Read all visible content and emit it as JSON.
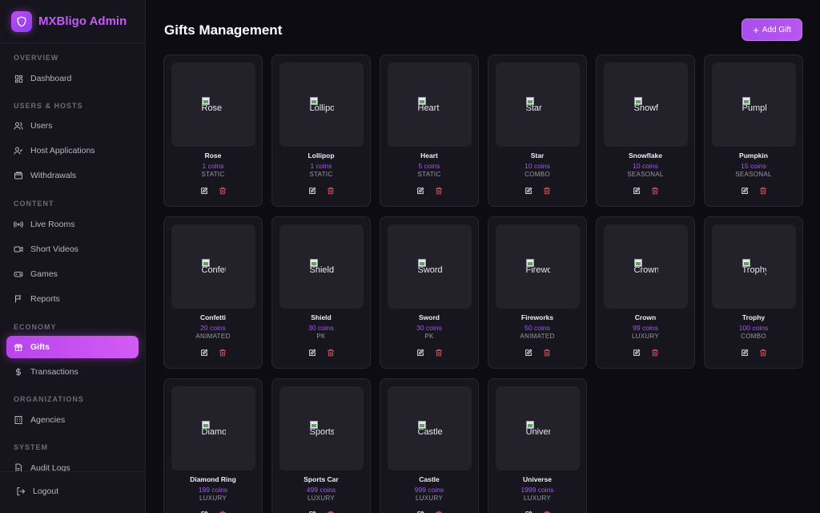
{
  "brand": {
    "name": "MXBligo Admin"
  },
  "sidebar": {
    "sections": [
      {
        "label": "OVERVIEW",
        "items": [
          {
            "label": "Dashboard",
            "icon": "dashboard-icon"
          }
        ]
      },
      {
        "label": "USERS & HOSTS",
        "items": [
          {
            "label": "Users",
            "icon": "users-icon"
          },
          {
            "label": "Host Applications",
            "icon": "user-check-icon"
          },
          {
            "label": "Withdrawals",
            "icon": "wallet-icon"
          }
        ]
      },
      {
        "label": "CONTENT",
        "items": [
          {
            "label": "Live Rooms",
            "icon": "broadcast-icon"
          },
          {
            "label": "Short Videos",
            "icon": "video-icon"
          },
          {
            "label": "Games",
            "icon": "gamepad-icon"
          },
          {
            "label": "Reports",
            "icon": "flag-icon"
          }
        ]
      },
      {
        "label": "ECONOMY",
        "items": [
          {
            "label": "Gifts",
            "icon": "gift-icon",
            "active": true
          },
          {
            "label": "Transactions",
            "icon": "dollar-icon"
          }
        ]
      },
      {
        "label": "ORGANIZATIONS",
        "items": [
          {
            "label": "Agencies",
            "icon": "building-icon"
          }
        ]
      },
      {
        "label": "SYSTEM",
        "items": [
          {
            "label": "Audit Logs",
            "icon": "file-icon"
          }
        ]
      }
    ],
    "logout": "Logout"
  },
  "header": {
    "title": "Gifts Management",
    "add_button": "Add Gift"
  },
  "colors": {
    "accent": "#b845ec",
    "price": "#a259f2",
    "delete": "#e0444c"
  },
  "gifts": [
    {
      "name": "Rose",
      "alt": "Rose",
      "price": "1 coins",
      "type": "STATIC"
    },
    {
      "name": "Lollipop",
      "alt": "Lollipop",
      "price": "1 coins",
      "type": "STATIC"
    },
    {
      "name": "Heart",
      "alt": "Heart",
      "price": "5 coins",
      "type": "STATIC"
    },
    {
      "name": "Star",
      "alt": "Star",
      "price": "10 coins",
      "type": "COMBO"
    },
    {
      "name": "Snowflake",
      "alt": "Snowflake",
      "price": "10 coins",
      "type": "SEASONAL"
    },
    {
      "name": "Pumpkin",
      "alt": "Pumpkin",
      "price": "15 coins",
      "type": "SEASONAL"
    },
    {
      "name": "Confetti",
      "alt": "Confetti",
      "price": "20 coins",
      "type": "ANIMATED"
    },
    {
      "name": "Shield",
      "alt": "Shield",
      "price": "30 coins",
      "type": "PK"
    },
    {
      "name": "Sword",
      "alt": "Sword",
      "price": "30 coins",
      "type": "PK"
    },
    {
      "name": "Fireworks",
      "alt": "Fireworks",
      "price": "50 coins",
      "type": "ANIMATED"
    },
    {
      "name": "Crown",
      "alt": "Crown",
      "price": "99 coins",
      "type": "LUXURY"
    },
    {
      "name": "Trophy",
      "alt": "Trophy",
      "price": "100 coins",
      "type": "COMBO"
    },
    {
      "name": "Diamond Ring",
      "alt": "Diamond Ring",
      "price": "199 coins",
      "type": "LUXURY"
    },
    {
      "name": "Sports Car",
      "alt": "Sports Car",
      "price": "499 coins",
      "type": "LUXURY"
    },
    {
      "name": "Castle",
      "alt": "Castle",
      "price": "999 coins",
      "type": "LUXURY"
    },
    {
      "name": "Universe",
      "alt": "Universe",
      "price": "1999 coins",
      "type": "LUXURY"
    }
  ]
}
